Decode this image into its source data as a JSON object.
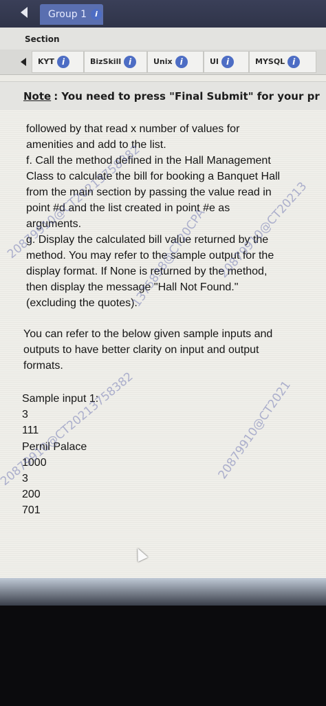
{
  "header": {
    "group_label": "Group 1",
    "info_glyph": "i"
  },
  "section": {
    "label": "Section"
  },
  "tabs": [
    {
      "label": "KYT"
    },
    {
      "label": "BizSkill"
    },
    {
      "label": "Unix"
    },
    {
      "label": "UI"
    },
    {
      "label": "MYSQL"
    }
  ],
  "note": {
    "label": "Note",
    "text": ": You need to press \"Final Submit\" for your pr"
  },
  "question": {
    "lines_top": [
      "followed by that read x number of values for",
      "amenities and add to the list.",
      "f. Call the method defined in the Hall Management",
      "Class to calculate the bill for booking a Banquet Hall",
      "from the main section by passing the value read in",
      "point #d and the list created in point #e as",
      "arguments.",
      "g. Display the calculated bill value returned by the",
      "method. You may refer to the sample output for the",
      "display format. If None is returned by the method,",
      "then display the message \"Hall Not Found.\"",
      "(excluding the quotes)."
    ],
    "lines_refer": [
      "You can refer to the below given sample inputs and",
      "outputs to have better clarity on input and output",
      "formats."
    ]
  },
  "sample_input": {
    "title": "Sample input 1:",
    "values": [
      "3",
      "111",
      "Pernil Palace",
      "1000",
      "3",
      "200",
      "701"
    ]
  },
  "watermarks": [
    "20879910@CT20213758382",
    "20879910@CT20213",
    "1375838@CT20CPA",
    "20879910@CT2021",
    "20879910@CT20213758382"
  ],
  "colors": {
    "topbar": "#353a52",
    "group_tab": "#5a6fb0",
    "info_dot": "#4d6dc4",
    "screen_bg": "#ecebe6"
  }
}
